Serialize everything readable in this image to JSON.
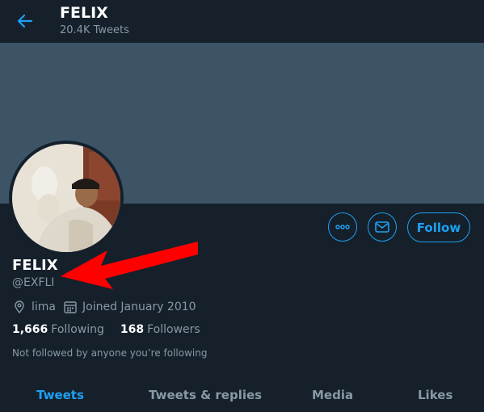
{
  "header": {
    "title": "FELIX",
    "subtitle": "20.4K Tweets"
  },
  "profile": {
    "name": "FELIX",
    "handle": "@EXFLI",
    "location": "lima",
    "joined": "Joined January 2010",
    "following_count": "1,666",
    "following_label": "Following",
    "followers_count": "168",
    "followers_label": "Followers",
    "followed_by": "Not followed by anyone you’re following"
  },
  "actions": {
    "follow_label": "Follow"
  },
  "tabs": [
    {
      "label": "Tweets",
      "active": true
    },
    {
      "label": "Tweets & replies"
    },
    {
      "label": "Media"
    },
    {
      "label": "Likes"
    }
  ],
  "icons": {
    "back": "arrow-left-icon",
    "more": "more-icon",
    "message": "envelope-icon",
    "location": "location-pin-icon",
    "calendar": "calendar-icon"
  },
  "colors": {
    "background": "#15202b",
    "banner": "#3d5466",
    "accent": "#1da1f2",
    "secondary_text": "#8899a6",
    "annotation_arrow": "#ff0000"
  }
}
